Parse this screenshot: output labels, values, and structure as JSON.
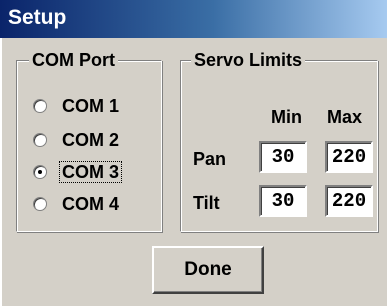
{
  "window": {
    "title": "Setup"
  },
  "com_port": {
    "label": "COM Port",
    "options": [
      {
        "label": "COM 1",
        "checked": false
      },
      {
        "label": "COM 2",
        "checked": false
      },
      {
        "label": "COM 3",
        "checked": true
      },
      {
        "label": "COM 4",
        "checked": false
      }
    ]
  },
  "servo_limits": {
    "label": "Servo Limits",
    "col_min": "Min",
    "col_max": "Max",
    "pan": {
      "label": "Pan",
      "min": "30",
      "max": "220"
    },
    "tilt": {
      "label": "Tilt",
      "min": "30",
      "max": "220"
    }
  },
  "buttons": {
    "done": "Done"
  }
}
